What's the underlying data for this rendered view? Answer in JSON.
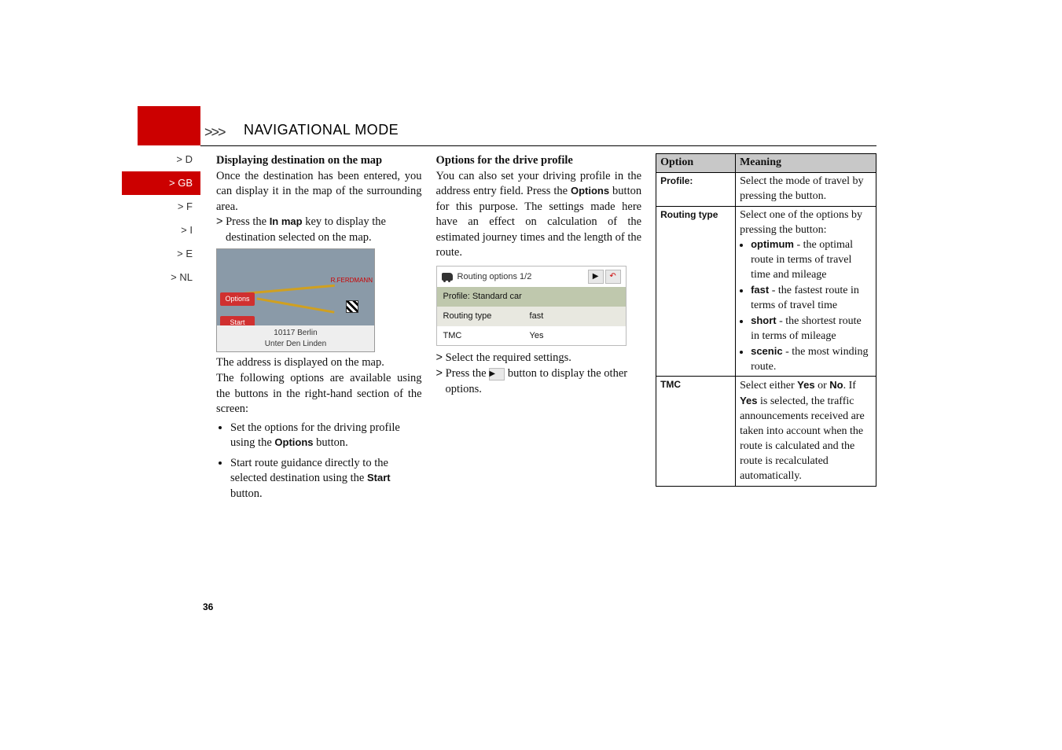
{
  "section_title": "NAVIGATIONAL MODE",
  "arrows_label": ">>>",
  "sidebar": {
    "items": [
      {
        "label": "> D"
      },
      {
        "label": "> GB"
      },
      {
        "label": "> F"
      },
      {
        "label": "> I"
      },
      {
        "label": "> E"
      },
      {
        "label": "> NL"
      }
    ]
  },
  "page_number": "36",
  "col1": {
    "heading": "Displaying destination on the map",
    "p1": "Once the destination has been entered, you can display it in the map of the surrounding area.",
    "step_prefix": ">",
    "step1_a": "Press the ",
    "step1_key": "In map",
    "step1_b": " key to display the destination selected on the map.",
    "map_options": "Options",
    "map_start": "Start",
    "map_addr_line1": "10117 Berlin",
    "map_addr_line2": "Unter Den Linden",
    "map_label_r": "R.FERDMANN",
    "p2": "The address is displayed on the map.",
    "p3": "The following options are available using the buttons in the right-hand section of the screen:",
    "b1_a": "Set the options for the driving profile using the ",
    "b1_key": "Options",
    "b1_b": " button.",
    "b2_a": "Start route guidance directly to the selected destination using the ",
    "b2_key": "Start",
    "b2_b": " button."
  },
  "col2": {
    "heading": "Options for the drive profile",
    "p1_a": "You can also set your driving profile in the address entry field. Press the ",
    "p1_key": "Options",
    "p1_b": " button for this purpose. The settings made here have an effect on calculation of the estimated journey times and the length of the route.",
    "ui_title": "Routing options 1/2",
    "ui_row0": "Profile: Standard car",
    "ui_row1_k": "Routing type",
    "ui_row1_v": "fast",
    "ui_row2_k": "TMC",
    "ui_row2_v": "Yes",
    "step1": "Select the required settings.",
    "step2_a": "Press the ",
    "step2_b": " button to display the other options.",
    "tri": "▶"
  },
  "col3": {
    "th1": "Option",
    "th2": "Meaning",
    "r1_k": "Profile:",
    "r1_v": "Select the mode of travel by pressing the button.",
    "r2_k": "Routing type",
    "r2_intro": "Select one of the options by pressing the button:",
    "r2_o1_k": "optimum",
    "r2_o1_v": " - the optimal route in terms of travel time and mileage",
    "r2_o2_k": "fast",
    "r2_o2_v": " - the fastest route in terms of travel time",
    "r2_o3_k": "short",
    "r2_o3_v": " - the shortest route in terms of mileage",
    "r2_o4_k": "scenic",
    "r2_o4_v": " - the most winding route.",
    "r3_k": "TMC",
    "r3_v_a": "Select either ",
    "r3_v_yes": "Yes",
    "r3_v_or": " or ",
    "r3_v_no": "No",
    "r3_v_b": ". If ",
    "r3_v_yes2": "Yes",
    "r3_v_c": " is selected, the traffic announcements received are taken into account when the route is calculated and the route is recalculated automatically."
  }
}
